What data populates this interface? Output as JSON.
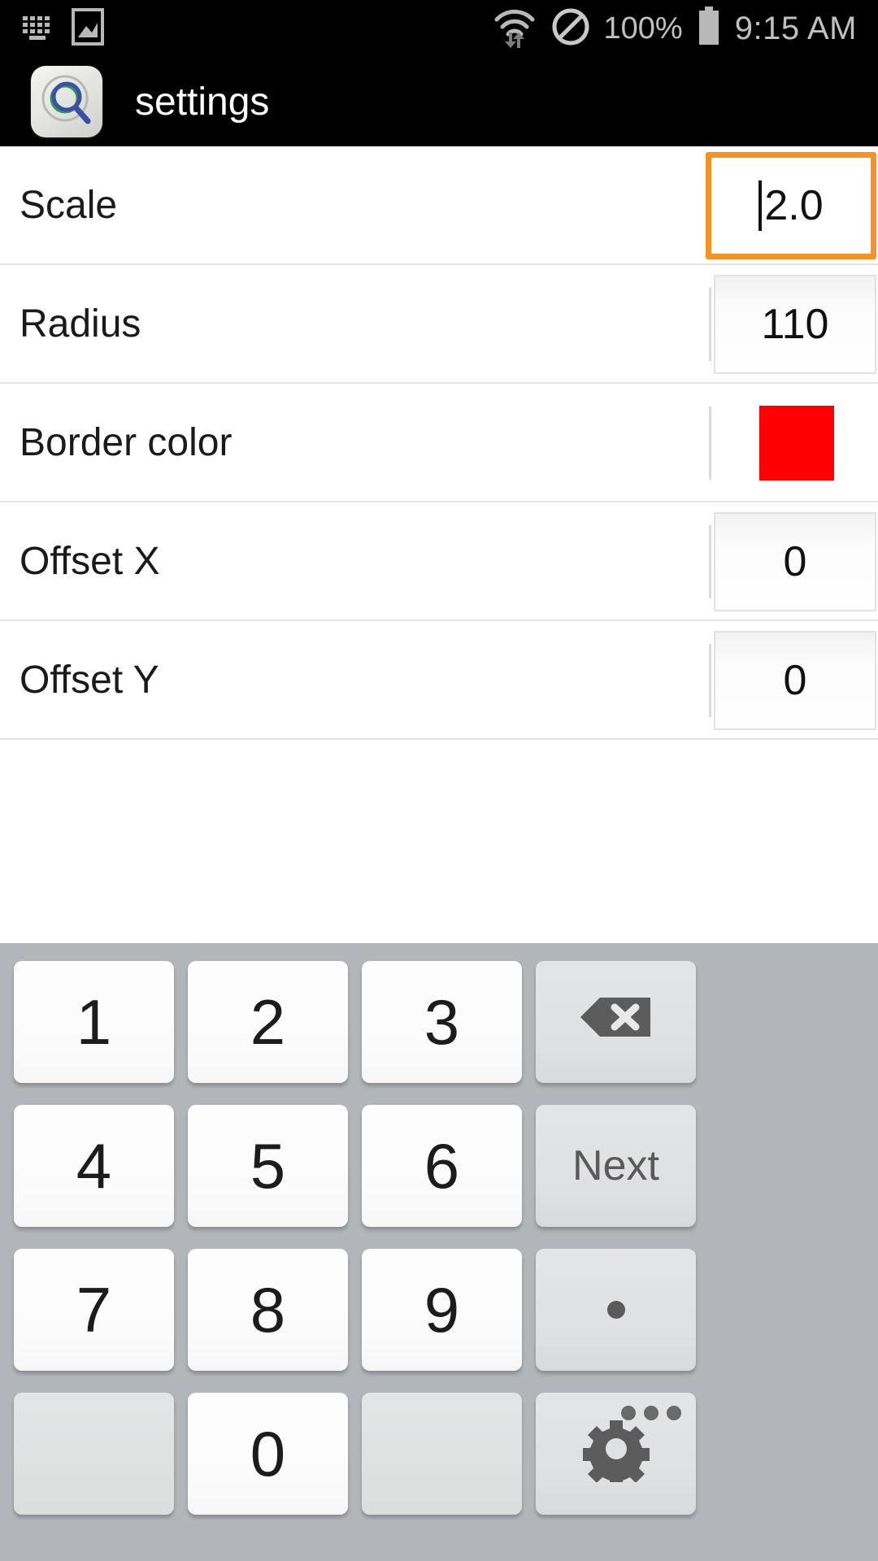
{
  "status_bar": {
    "icons_left": [
      "keyboard-icon",
      "screenshot-icon"
    ],
    "wifi_icon": "wifi-icon",
    "dnd_icon": "do-not-disturb-icon",
    "battery_percent": "100%",
    "battery_icon": "battery-full-icon",
    "time": "9:15 AM"
  },
  "app_bar": {
    "icon": "magnifier-app-icon",
    "title": "settings"
  },
  "settings": {
    "rows": [
      {
        "label": "Scale",
        "type": "number",
        "value": "2.0",
        "focused": true
      },
      {
        "label": "Radius",
        "type": "number",
        "value": "110",
        "focused": false
      },
      {
        "label": "Border color",
        "type": "color",
        "value": "#FF0000",
        "focused": false
      },
      {
        "label": "Offset X",
        "type": "number",
        "value": "0",
        "focused": false
      },
      {
        "label": "Offset Y",
        "type": "number",
        "value": "0",
        "focused": false
      }
    ]
  },
  "keyboard": {
    "rows": [
      [
        {
          "label": "1",
          "kind": "num"
        },
        {
          "label": "2",
          "kind": "num"
        },
        {
          "label": "3",
          "kind": "num"
        },
        {
          "label": "",
          "kind": "backspace",
          "icon": "backspace-icon"
        }
      ],
      [
        {
          "label": "4",
          "kind": "num"
        },
        {
          "label": "5",
          "kind": "num"
        },
        {
          "label": "6",
          "kind": "num"
        },
        {
          "label": "Next",
          "kind": "fn"
        }
      ],
      [
        {
          "label": "7",
          "kind": "num"
        },
        {
          "label": "8",
          "kind": "num"
        },
        {
          "label": "9",
          "kind": "num"
        },
        {
          "label": ".",
          "kind": "period",
          "icon": "period-icon"
        }
      ],
      [
        {
          "label": "",
          "kind": "blank"
        },
        {
          "label": "0",
          "kind": "num"
        },
        {
          "label": "",
          "kind": "blank"
        },
        {
          "label": "",
          "kind": "settings",
          "icon": "gear-icon"
        }
      ]
    ]
  },
  "colors": {
    "accent_focus": "#F59222",
    "border_color_swatch": "#FF0000",
    "keyboard_bg": "#B2B6B9",
    "status_bar_bg": "#000000"
  }
}
